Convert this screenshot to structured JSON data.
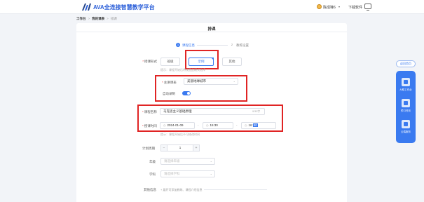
{
  "header": {
    "brand": "AVA全连接智慧教学平台",
    "user_name": "陈成锋6",
    "download": "下载软件"
  },
  "breadcrumb": {
    "home": "工作台",
    "course": "我的课表",
    "current": "排课"
  },
  "page": {
    "title": "排课",
    "steps": [
      {
        "num": "1",
        "label": "课程信息",
        "active": true
      },
      {
        "num": "2",
        "label": "教练设置",
        "active": false
      }
    ]
  },
  "form": {
    "mode_label": "授课形式",
    "mode_options": [
      "班级",
      "示例",
      "其他"
    ],
    "mode_selected": "示例",
    "mode_hint": "提示：课程开始后将设置此模式选择",
    "board_label": "主讲课表",
    "board_value": "美丽地球城市",
    "auto_record_label": "自动录制",
    "auto_record_on": true,
    "course_name_label": "课程名称",
    "course_name_value": "马克思主义基础原理",
    "course_name_counter": "9/30字",
    "time_label": "授课时间",
    "date_value": "2024-01-09",
    "start_time": "15:30",
    "end_time_prefix": "16:",
    "end_time_selected": "50",
    "time_hint": "提示：课程开始后不可修改时间",
    "repeat_label": "计划周期",
    "repeat_value": "1",
    "grade_label": "年级",
    "grade_placeholder": "请选择年级",
    "subject_label": "学科",
    "subject_placeholder": "请选择学科",
    "more_label": "其他信息",
    "more_text": "展开可添加教练、课程介绍信息"
  },
  "side": {
    "pill": "返回首页",
    "items": [
      "AI助工作台",
      "预习任务",
      "云端服务"
    ]
  },
  "colors": {
    "accent": "#3a7af0",
    "annotation_red": "#e02424"
  }
}
